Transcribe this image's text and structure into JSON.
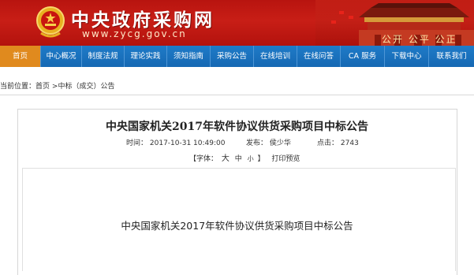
{
  "header": {
    "site_title": "中央政府采购网",
    "site_url": "www.zycg.gov.cn",
    "slogan": "公开 公平 公正"
  },
  "nav": {
    "items": [
      {
        "label": "首页",
        "active": true
      },
      {
        "label": "中心概况"
      },
      {
        "label": "制度法规"
      },
      {
        "label": "理论实践"
      },
      {
        "label": "须知指南"
      },
      {
        "label": "采购公告"
      },
      {
        "label": "在线培训"
      },
      {
        "label": "在线问答"
      },
      {
        "label": "CA 服务"
      },
      {
        "label": "下载中心"
      },
      {
        "label": "联系我们"
      }
    ]
  },
  "breadcrumb": {
    "prefix": "当前位置：",
    "home": "首页",
    "separator": ">",
    "section": "中标（成交）公告"
  },
  "article": {
    "title": "中央国家机关2017年软件协议供货采购项目中标公告",
    "time_label": "时间：",
    "time_value": "2017-10-31 10:49:00",
    "publisher_label": "发布：",
    "publisher_value": "侯少华",
    "clicks_label": "点击：",
    "clicks_value": "2743",
    "font_label": "【字体：",
    "font_large": "大",
    "font_medium": "中",
    "font_small": "小",
    "font_close": "】",
    "print_preview": "打印预览",
    "content_title": "中央国家机关2017年软件协议供货采购项目中标公告"
  },
  "colors": {
    "banner_red": "#c81e16",
    "nav_blue": "#1a72be",
    "nav_active": "#e08a1e"
  }
}
